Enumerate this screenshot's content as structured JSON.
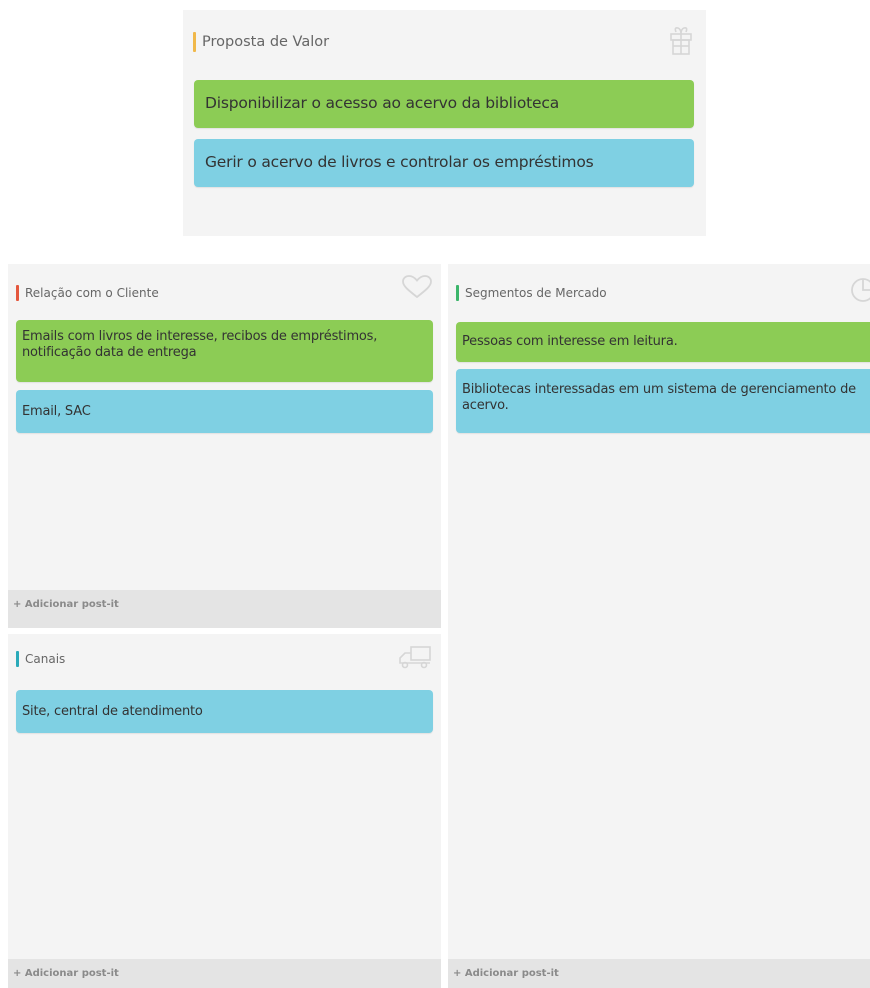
{
  "colors": {
    "panel_bg": "#f4f4f4",
    "note_green": "#8ccc55",
    "note_blue": "#7fd0e3",
    "accent_proposta": "#f0b84a",
    "accent_relacao": "#e4573d",
    "accent_canais": "#2aaab9",
    "accent_segmentos": "#3bb56a"
  },
  "proposta_valor": {
    "title": "Proposta de Valor",
    "icon": "gift-icon",
    "notes": [
      "Disponibilizar o acesso ao acervo da biblioteca",
      "Gerir o acervo de livros e controlar os empréstimos"
    ]
  },
  "relacao_cliente": {
    "title": "Relação com o Cliente",
    "icon": "heart-icon",
    "notes": [
      "Emails com livros de interesse, recibos de empréstimos, notificação data de entrega",
      "Email, SAC"
    ],
    "add_label": "+ Adicionar post-it"
  },
  "canais": {
    "title": "Canais",
    "icon": "truck-icon",
    "notes": [
      "Site, central de atendimento"
    ],
    "add_label": "+ Adicionar post-it"
  },
  "segmentos_mercado": {
    "title": "Segmentos de Mercado",
    "icon": "pie-chart-icon",
    "notes": [
      "Pessoas com interesse em leitura.",
      "Bibliotecas interessadas em um sistema de gerenciamento de acervo."
    ],
    "add_label": "+ Adicionar post-it"
  }
}
